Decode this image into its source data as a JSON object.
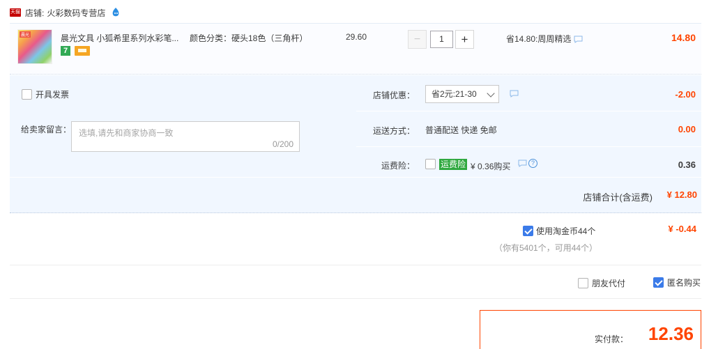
{
  "shop": {
    "badge": "天猫",
    "label": "店铺:",
    "name": "火彩数码专营店"
  },
  "item": {
    "thumb_label": "晨光",
    "title": "晨光文具 小狐希里系列水彩笔...",
    "badge_days": "7",
    "sku": "颜色分类：硬头18色（三角杆）",
    "price": "29.60",
    "quantity": "1",
    "minus_label": "−",
    "plus_label": "+",
    "saving": "省14.80:周周精选",
    "total": "14.80"
  },
  "invoice": {
    "label": "开具发票"
  },
  "message": {
    "label": "给卖家留言：",
    "placeholder": "选填,请先和商家协商一致",
    "counter": "0/200"
  },
  "shop_discount": {
    "label": "店铺优惠：",
    "selected": "省2元:21-30",
    "value": "-2.00"
  },
  "shipping": {
    "label": "运送方式：",
    "method": "普通配送 快递 免邮",
    "value": "0.00"
  },
  "insurance": {
    "label": "运费险：",
    "tag": "运费险",
    "text": "¥ 0.36购买",
    "help": "?",
    "value": "0.36"
  },
  "subtotal": {
    "label": "店铺合计(含运费)",
    "value": "¥ 12.80"
  },
  "coins": {
    "label": "使用淘金币44个",
    "sub": "（你有5401个，可用44个）",
    "value": "¥ -0.44"
  },
  "friend_pay": {
    "label": "朋友代付"
  },
  "anonymous": {
    "label": "匿名购买"
  },
  "payment": {
    "label": "实付款：",
    "value": "12.36"
  },
  "colors": {
    "accent": "#ff4400",
    "panel": "#f1f7ff",
    "checkbox_on": "#3b7be9",
    "insurance_tag": "#2fa83f"
  }
}
